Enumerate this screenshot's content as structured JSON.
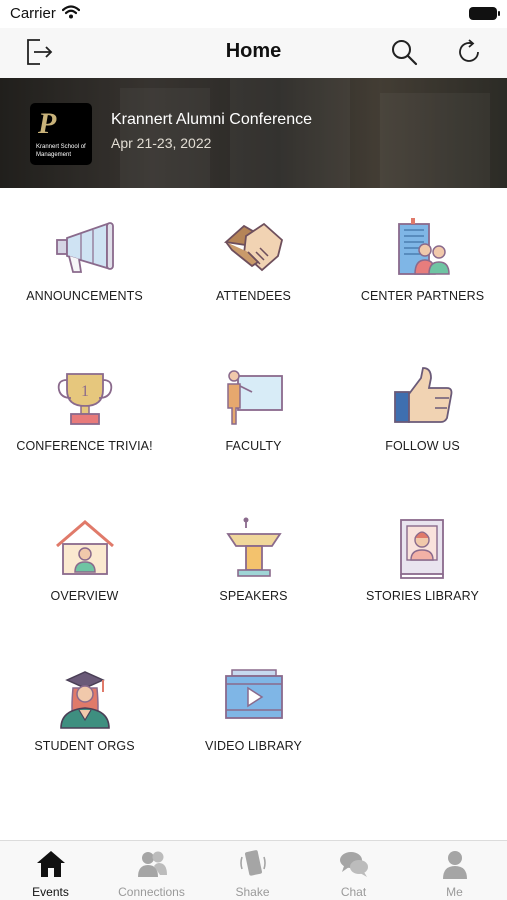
{
  "status": {
    "carrier": "Carrier"
  },
  "nav": {
    "title": "Home"
  },
  "event": {
    "title": "Krannert Alumni Conference",
    "dates": "Apr 21-23, 2022",
    "logo_text": "Krannert School of Management"
  },
  "tiles": [
    {
      "label": "ANNOUNCEMENTS",
      "icon": "megaphone-icon"
    },
    {
      "label": "ATTENDEES",
      "icon": "handshake-icon"
    },
    {
      "label": "CENTER PARTNERS",
      "icon": "building-people-icon"
    },
    {
      "label": "CONFERENCE TRIVIA!",
      "icon": "trophy-icon"
    },
    {
      "label": "FACULTY",
      "icon": "teacher-board-icon"
    },
    {
      "label": "FOLLOW US",
      "icon": "thumbs-up-icon"
    },
    {
      "label": "OVERVIEW",
      "icon": "house-person-icon"
    },
    {
      "label": "SPEAKERS",
      "icon": "podium-icon"
    },
    {
      "label": "STORIES LIBRARY",
      "icon": "book-person-icon"
    },
    {
      "label": "STUDENT ORGS",
      "icon": "graduate-icon"
    },
    {
      "label": "VIDEO LIBRARY",
      "icon": "video-play-icon"
    }
  ],
  "tabs": [
    {
      "label": "Events",
      "icon": "house-icon",
      "active": true
    },
    {
      "label": "Connections",
      "icon": "people-icon",
      "active": false
    },
    {
      "label": "Shake",
      "icon": "phone-shake-icon",
      "active": false
    },
    {
      "label": "Chat",
      "icon": "chat-bubbles-icon",
      "active": false
    },
    {
      "label": "Me",
      "icon": "person-icon",
      "active": false
    }
  ],
  "colors": {
    "accent_gold": "#c9b37a",
    "icon_outline": "#8a6a8c",
    "active_tab": "#111111",
    "inactive_tab": "#9a9a9a"
  }
}
